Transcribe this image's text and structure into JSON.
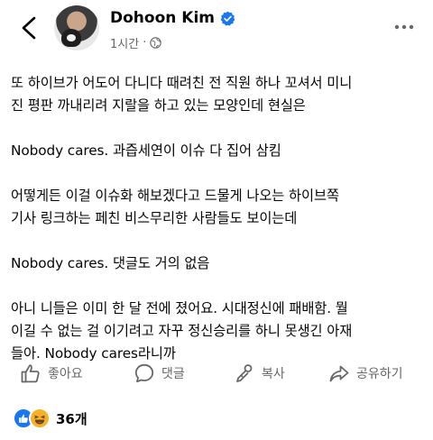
{
  "header": {
    "author_name": "Dohoon Kim",
    "timestamp": "1시간",
    "privacy_icon": "globe-icon",
    "verified_color": "#1877f2"
  },
  "post": {
    "paragraphs": [
      "또 하이브가 어도어 다니다 때려친 전 직원 하나 꼬셔서 미니\n진 평판 까내리려 지랄을 하고 있는 모양인데 현실은",
      "Nobody cares. 과즙세연이 이슈 다 집어 삼킴",
      "어떻게든 이걸 이슈화 해보겠다고 드물게 나오는 하이브쪽\n기사 링크하는 페친 비스무리한 사람들도 보이는데",
      "Nobody cares. 댓글도 거의 없음",
      "아니 니들은 이미 한 달 전에 졌어요. 시대정신에 패배함. 뭘\n이길 수 없는 걸 이기려고 자꾸 정신승리를 하니 못생긴 아재\n들아. Nobody cares라니까"
    ]
  },
  "actions": {
    "like_label": "좋아요",
    "comment_label": "댓글",
    "share_copy_label": "복사",
    "share_label": "공유하기"
  },
  "reactions": {
    "count": "36개",
    "like_color": "#1877f2",
    "haha_color": "#f7b125"
  }
}
